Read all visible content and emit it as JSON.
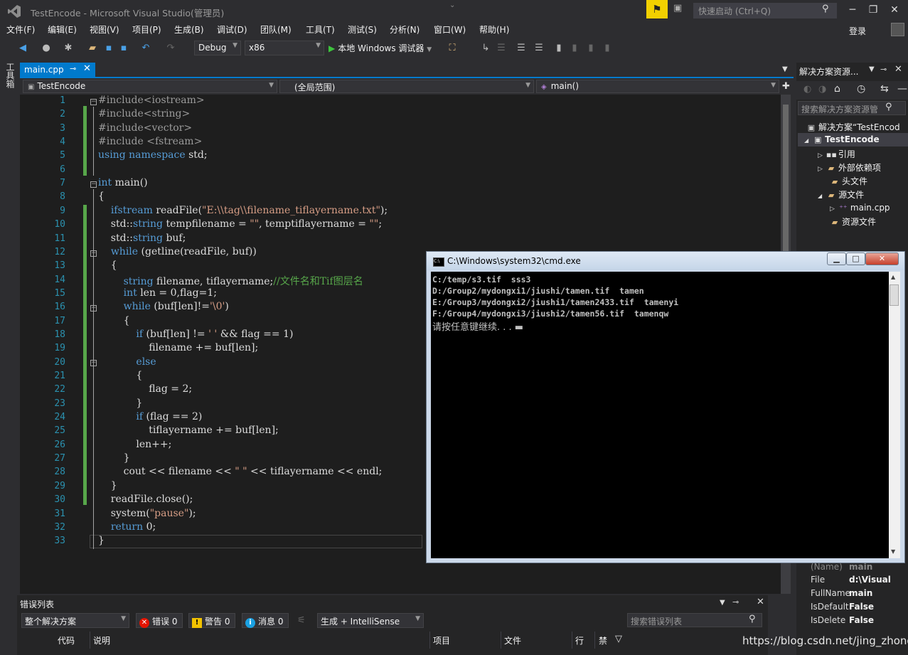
{
  "window": {
    "title": "TestEncode - Microsoft Visual Studio(管理员)",
    "quick_launch_placeholder": "快速启动 (Ctrl+Q)",
    "login": "登录"
  },
  "menu": [
    "文件(F)",
    "编辑(E)",
    "视图(V)",
    "项目(P)",
    "生成(B)",
    "调试(D)",
    "团队(M)",
    "工具(T)",
    "测试(S)",
    "分析(N)",
    "窗口(W)",
    "帮助(H)"
  ],
  "toolbar": {
    "config": "Debug",
    "platform": "x86",
    "run_label": "本地 Windows 调试器"
  },
  "toolbox_tab": "工具箱",
  "editor": {
    "tab_label": "main.cpp",
    "nav_project": "TestEncode",
    "nav_scope": "(全局范围)",
    "nav_member": "main()",
    "line_numbers": [
      "1",
      "2",
      "3",
      "4",
      "5",
      "6",
      "7",
      "8",
      "9",
      "10",
      "11",
      "12",
      "13",
      "14",
      "15",
      "16",
      "17",
      "18",
      "19",
      "20",
      "21",
      "22",
      "23",
      "24",
      "25",
      "26",
      "27",
      "28",
      "29",
      "30",
      "31",
      "32",
      "33"
    ],
    "code": [
      [
        [
          "pp",
          "#include<iostream>"
        ]
      ],
      [
        [
          "pp",
          "#include<string>"
        ]
      ],
      [
        [
          "pp",
          "#include<vector>"
        ]
      ],
      [
        [
          "pp",
          "#include <fstream>"
        ]
      ],
      [
        [
          "kw",
          "using namespace "
        ],
        [
          "tx",
          "std;"
        ]
      ],
      [],
      [
        [
          "kw",
          "int "
        ],
        [
          "tx",
          "main()"
        ]
      ],
      [
        [
          "tx",
          "{"
        ]
      ],
      [
        [
          "tx",
          "    "
        ],
        [
          "kw",
          "ifstream "
        ],
        [
          "tx",
          "readFile("
        ],
        [
          "st",
          "\"E:\\\\tag\\\\filename_tiflayername.txt\""
        ],
        [
          "tx",
          ");"
        ]
      ],
      [
        [
          "tx",
          "    std::"
        ],
        [
          "kw",
          "string "
        ],
        [
          "tx",
          "tempfilename = "
        ],
        [
          "st",
          "\"\""
        ],
        [
          "tx",
          ", temptiflayername = "
        ],
        [
          "st",
          "\"\""
        ],
        [
          "tx",
          ";"
        ]
      ],
      [
        [
          "tx",
          "    std::"
        ],
        [
          "kw",
          "string "
        ],
        [
          "tx",
          "buf;"
        ]
      ],
      [
        [
          "tx",
          "    "
        ],
        [
          "kw",
          "while "
        ],
        [
          "tx",
          "(getline(readFile, buf))"
        ]
      ],
      [
        [
          "tx",
          "    {"
        ]
      ],
      [
        [
          "tx",
          "        "
        ],
        [
          "kw",
          "string "
        ],
        [
          "tx",
          "filename, tiflayername;"
        ],
        [
          "cm",
          "//文件名和Tif图层名"
        ]
      ],
      [
        [
          "tx",
          "        "
        ],
        [
          "kw",
          "int "
        ],
        [
          "tx",
          "len = 0,flag=1;"
        ]
      ],
      [
        [
          "tx",
          "        "
        ],
        [
          "kw",
          "while "
        ],
        [
          "tx",
          "(buf[len]!="
        ],
        [
          "st",
          "'\\0'"
        ],
        [
          "tx",
          ")"
        ]
      ],
      [
        [
          "tx",
          "        {"
        ]
      ],
      [
        [
          "tx",
          "            "
        ],
        [
          "kw",
          "if "
        ],
        [
          "tx",
          "(buf[len] != "
        ],
        [
          "st",
          "' '"
        ],
        [
          "tx",
          " && flag == 1)"
        ]
      ],
      [
        [
          "tx",
          "                filename += buf[len];"
        ]
      ],
      [
        [
          "tx",
          "            "
        ],
        [
          "kw",
          "else"
        ]
      ],
      [
        [
          "tx",
          "            {"
        ]
      ],
      [
        [
          "tx",
          "                flag = 2;"
        ]
      ],
      [
        [
          "tx",
          "            }"
        ]
      ],
      [
        [
          "tx",
          "            "
        ],
        [
          "kw",
          "if "
        ],
        [
          "tx",
          "(flag == 2)"
        ]
      ],
      [
        [
          "tx",
          "                tiflayername += buf[len];"
        ]
      ],
      [
        [
          "tx",
          "            len++;"
        ]
      ],
      [
        [
          "tx",
          "        }"
        ]
      ],
      [
        [
          "tx",
          "        cout << filename << "
        ],
        [
          "st",
          "\" \""
        ],
        [
          "tx",
          " << tiflayername << endl;"
        ]
      ],
      [
        [
          "tx",
          "    }"
        ]
      ],
      [
        [
          "tx",
          "    readFile.close();"
        ]
      ],
      [
        [
          "tx",
          "    system("
        ],
        [
          "st",
          "\"pause\""
        ],
        [
          "tx",
          ");"
        ]
      ],
      [
        [
          "tx",
          "    "
        ],
        [
          "kw",
          "return "
        ],
        [
          "tx",
          "0;"
        ]
      ],
      [
        [
          "tx",
          "}"
        ]
      ]
    ]
  },
  "solution_explorer": {
    "title": "解决方案资源...",
    "search_placeholder": "搜索解决方案资源管",
    "items": [
      {
        "label": "解决方案“TestEncod",
        "icon": "solution-icon"
      },
      {
        "label": "TestEncode",
        "icon": "project-icon"
      },
      {
        "label": "引用",
        "icon": "references-icon"
      },
      {
        "label": "外部依赖项",
        "icon": "folder-icon"
      },
      {
        "label": "头文件",
        "icon": "folder-icon"
      },
      {
        "label": "源文件",
        "icon": "folder-icon"
      },
      {
        "label": "main.cpp",
        "icon": "cpp-file-icon"
      },
      {
        "label": "资源文件",
        "icon": "folder-icon"
      }
    ]
  },
  "properties": [
    {
      "key": "(Name)",
      "value": "main"
    },
    {
      "key": "File",
      "value": "d:\\Visual"
    },
    {
      "key": "FullName",
      "value": "main"
    },
    {
      "key": "IsDefault",
      "value": "False"
    },
    {
      "key": "IsDelete",
      "value": "False"
    }
  ],
  "error_list": {
    "title": "错误列表",
    "scope": "整个解决方案",
    "errors": "错误 0",
    "warnings": "警告 0",
    "messages": "消息 0",
    "build_filter": "生成 + IntelliSense",
    "search_placeholder": "搜索错误列表",
    "columns": [
      "代码",
      "说明",
      "项目",
      "文件",
      "行",
      "禁"
    ]
  },
  "cmd": {
    "title": "C:\\Windows\\system32\\cmd.exe",
    "lines": [
      "C:/temp/s3.tif  sss3",
      "D:/Group2/mydongxi1/jiushi/tamen.tif  tamen",
      "E:/Group3/mydongxi2/jiushi1/tamen2433.tif  tamenyi",
      "F:/Group4/mydongxi3/jiushi2/tamen56.tif  tamenqw",
      "请按任意键继续. . . ▬"
    ]
  },
  "watermark": "https://blog.csdn.net/jing_zhong"
}
